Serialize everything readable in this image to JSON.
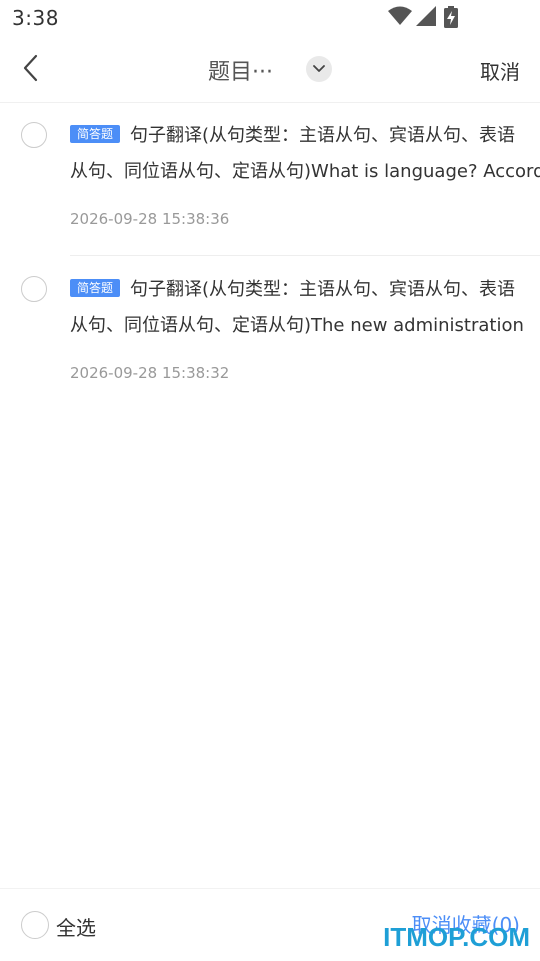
{
  "status_bar": {
    "time": "3:38",
    "icons": [
      "wifi-icon",
      "cellular-signal-icon",
      "battery-charging-icon"
    ]
  },
  "header": {
    "back_icon": "chevron-left-icon",
    "title": "题目···",
    "dropdown_icon": "chevron-down-icon",
    "cancel_label": "取消"
  },
  "items": [
    {
      "tag": "简答题",
      "text_line1": "句子翻译(从句类型：主语从句、宾语从句、表语",
      "text_line2": "从句、同位语从句、定语从句)What is language? According",
      "time": "2026-09-28 15:38:36"
    },
    {
      "tag": "简答题",
      "text_line1": "句子翻译(从句类型：主语从句、宾语从句、表语",
      "text_line2": "从句、同位语从句、定语从句)The new administration",
      "time": "2026-09-28 15:38:32"
    }
  ],
  "footer": {
    "select_all_label": "全选",
    "unfavorite_label": "取消收藏(0)"
  },
  "watermark": "ITMOP.COM",
  "colors": {
    "accent": "#4c8ef7",
    "text": "#333333",
    "muted": "#999999",
    "watermark": "#1e9fd6"
  }
}
